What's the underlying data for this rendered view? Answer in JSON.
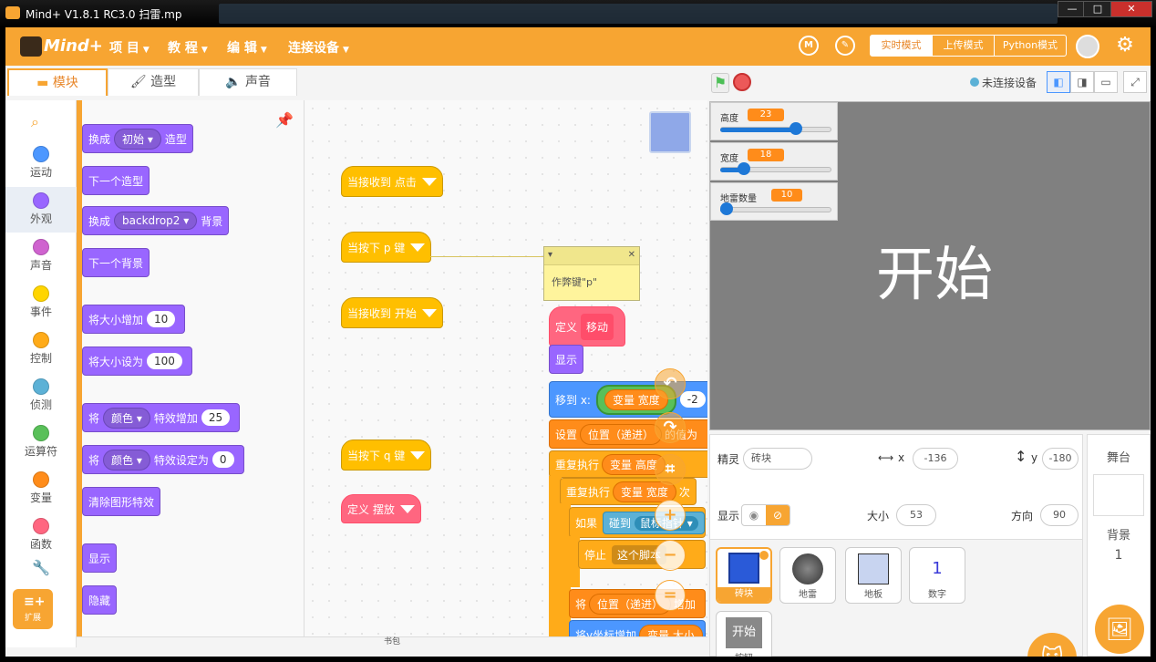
{
  "window": {
    "title": "Mind+ V1.8.1 RC3.0   扫雷.mp"
  },
  "menu": {
    "items": [
      "项 目",
      "教 程",
      "编 辑",
      "连接设备"
    ],
    "modes": [
      "实时模式",
      "上传模式",
      "Python模式"
    ]
  },
  "tabs": [
    "模块",
    "造型",
    "声音"
  ],
  "categories": [
    {
      "label": "运动",
      "color": "#4c97ff"
    },
    {
      "label": "外观",
      "color": "#9966ff"
    },
    {
      "label": "声音",
      "color": "#cf63cf"
    },
    {
      "label": "事件",
      "color": "#ffd500"
    },
    {
      "label": "控制",
      "color": "#ffab19"
    },
    {
      "label": "侦测",
      "color": "#5cb1d6"
    },
    {
      "label": "运算符",
      "color": "#59c059"
    },
    {
      "label": "变量",
      "color": "#ff8c1a"
    },
    {
      "label": "函数",
      "color": "#ff6680"
    }
  ],
  "extension_label": "扩展",
  "palette": {
    "b1": {
      "pre": "换成",
      "dd": "初始",
      "post": "造型"
    },
    "b2": "下一个造型",
    "b3": {
      "pre": "换成",
      "dd": "backdrop2",
      "post": "背景"
    },
    "b4": "下一个背景",
    "b5": {
      "pre": "将大小增加",
      "val": "10"
    },
    "b6": {
      "pre": "将大小设为",
      "val": "100"
    },
    "b7": {
      "pre": "将",
      "dd": "颜色",
      "post": "特效增加",
      "val": "25"
    },
    "b8": {
      "pre": "将",
      "dd": "颜色",
      "post": "特效设定为",
      "val": "0"
    },
    "b9": "清除图形特效",
    "b10": "显示",
    "b11": "隐藏"
  },
  "script": {
    "h1": "当接收到 点击",
    "h2": "当按下 p 键",
    "h3": "当接收到 开始",
    "h4": "当按下 q 键",
    "h5": "定义 摆放",
    "comment": "作弊键\"p\"",
    "define": "定义",
    "define_name": "移动",
    "show": "显示",
    "goto": "移到 x:",
    "var_width": "变量 宽度",
    "neg2": "-2",
    "set": "设置",
    "pos_var": "位置（递进）",
    "set_tail": "的值为",
    "repeat": "重复执行",
    "var_height": "变量 高度",
    "times": "次",
    "if": "如果",
    "touch": "碰到",
    "touch_target": "鼠标指针",
    "stop": "停止",
    "this_script": "这个脚本",
    "inc": "将",
    "inc_var": "位置（递进）",
    "inc_tail": "增加",
    "y_inc": "将y坐标增加",
    "var_size": "变量 大小"
  },
  "bag_label": "书包",
  "stage_header": {
    "connection": "未连接设备"
  },
  "monitors": [
    {
      "label": "高度",
      "value": 23,
      "fraction": 0.7
    },
    {
      "label": "宽度",
      "value": 18,
      "fraction": 0.18
    },
    {
      "label": "地雷数量",
      "value": 10,
      "fraction": 0.0
    }
  ],
  "stage_text": "开始",
  "sprite_info": {
    "sprite_label": "精灵",
    "sprite_name": "砖块",
    "x_label": "x",
    "x": "-136",
    "y_label": "y",
    "y": "-180",
    "show_label": "显示",
    "size_label": "大小",
    "size": "53",
    "dir_label": "方向",
    "dir": "90"
  },
  "sprites": [
    "砖块",
    "地雷",
    "地板",
    "数字",
    "按钮"
  ],
  "number_sprite_glyph": "1",
  "button_sprite_glyph": "开始",
  "backdrop": {
    "header": "舞台",
    "label": "背景",
    "count": "1"
  }
}
